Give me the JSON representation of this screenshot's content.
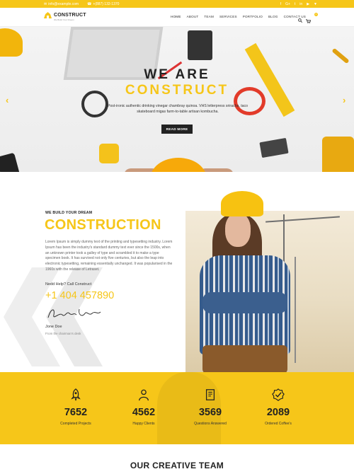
{
  "topbar": {
    "email": "info@example.com",
    "phone": "+(887) 132-1370",
    "social": [
      "f",
      "G+",
      "t",
      "in",
      "▶",
      "▼"
    ]
  },
  "nav": {
    "logo_name": "CONSTRUCT",
    "logo_tag": "We Build Your Dream",
    "menu": [
      "HOME",
      "ABOUT",
      "TEAM",
      "SERVICES",
      "PORTFOLIO",
      "BLOG",
      "CONTACT US"
    ],
    "cart_count": "0"
  },
  "hero": {
    "line1": "WE ARE",
    "line2": "CONSTRUCT",
    "text": "Post-ironic authentic drinking vinegar chambray quinoa. VHS letterpress sriracha, taco skateboard migas farm-to-table artisan kombucha.",
    "button": "READ MORE",
    "prev": "‹",
    "next": "›"
  },
  "about": {
    "kicker": "WE BUILD YOUR DREAM",
    "title": "CONSTRUCTION",
    "body": "Lorem Ipsum is simply dummy text of the printing and typesetting industry. Lorem Ipsum has been the industry's standard dummy text ever since the 1500s, when an unknown printer took a galley of type and scrambled it to make a type specimen book. It has survived not only five centuries, but also the leap into electronic typesetting, remaining essentially unchanged. It was popularised in the 1960s with the release of Letraset.",
    "need": "Nedd Help? Call Construct",
    "phone": "+1 404 457890",
    "name": "Jone Doe",
    "role": "From the chairman's desk"
  },
  "stats": [
    {
      "icon": "rocket-icon",
      "value": "7652",
      "label": "Completed Projects"
    },
    {
      "icon": "users-icon",
      "value": "4562",
      "label": "Happy Clients"
    },
    {
      "icon": "book-icon",
      "value": "3569",
      "label": "Questions Answered"
    },
    {
      "icon": "check-badge-icon",
      "value": "2089",
      "label": "Ordered Coffee's"
    }
  ],
  "team": {
    "title": "OUR CREATIVE TEAM"
  },
  "colors": {
    "accent": "#f6c619",
    "dark": "#222222"
  }
}
